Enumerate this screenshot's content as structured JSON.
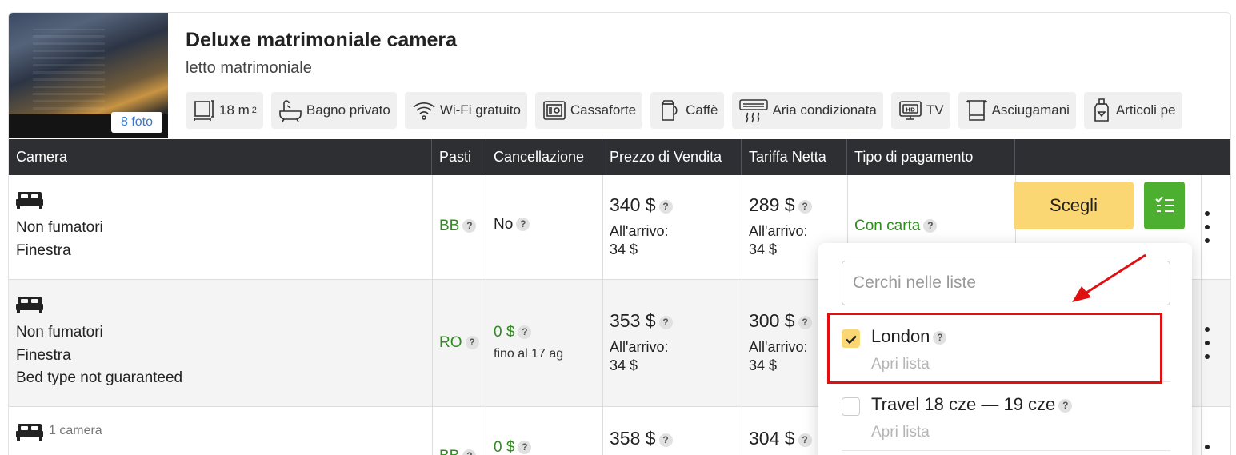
{
  "room": {
    "photo_badge": "8 foto",
    "title": "Deluxe matrimoniale camera",
    "subtitle": "letto matrimoniale",
    "amenities": [
      {
        "icon": "room-size-icon",
        "label": "18 m",
        "sup": "2"
      },
      {
        "icon": "bathtub-icon",
        "label": "Bagno privato"
      },
      {
        "icon": "wifi-icon",
        "label": "Wi-Fi gratuito"
      },
      {
        "icon": "safe-icon",
        "label": "Cassaforte"
      },
      {
        "icon": "kettle-icon",
        "label": "Caffè"
      },
      {
        "icon": "air-conditioner-icon",
        "label": "Aria condizionata"
      },
      {
        "icon": "tv-icon",
        "label": "TV"
      },
      {
        "icon": "towel-icon",
        "label": "Asciugamani"
      },
      {
        "icon": "toiletries-icon",
        "label": "Articoli pe"
      }
    ]
  },
  "table": {
    "headers": [
      "Camera",
      "Pasti",
      "Cancellazione",
      "Prezzo di Vendita",
      "Tariffa Netta",
      "Tipo di pagamento"
    ],
    "rows": [
      {
        "camera": [
          "Non fumatori",
          "Finestra"
        ],
        "pasti": "BB",
        "cancellazione": "No",
        "prezzo": "340 $",
        "prezzo_arrivo_label": "All'arrivo:",
        "prezzo_arrivo": "34 $",
        "netta": "289 $",
        "netta_arrivo_label": "All'arrivo:",
        "netta_arrivo": "34 $",
        "pagamento": "Con carta"
      },
      {
        "camera": [
          "Non fumatori",
          "Finestra",
          "Bed type not guaranteed"
        ],
        "pasti": "RO",
        "cancellazione": "0 $",
        "cancellazione_note": "fino al 17 ag",
        "prezzo": "353 $",
        "prezzo_arrivo_label": "All'arrivo:",
        "prezzo_arrivo": "34 $",
        "netta": "300 $",
        "netta_arrivo_label": "All'arrivo:",
        "netta_arrivo": "34 $"
      },
      {
        "camera_count": "1 camera",
        "pasti": "BB",
        "cancellazione": "0 $",
        "prezzo": "358 $",
        "netta": "304 $"
      }
    ],
    "select_button": "Scegli",
    "help_glyph": "?"
  },
  "dropdown": {
    "search_placeholder": "Cerchi nelle liste",
    "items": [
      {
        "label": "London",
        "link": "Apri lista",
        "checked": true
      },
      {
        "label": "Travel 18 cze — 19 cze",
        "link": "Apri lista",
        "checked": false
      }
    ]
  },
  "colors": {
    "header_bg": "#2d2f33",
    "select_button": "#fbd774",
    "list_button": "#4caf30",
    "highlight": "#e01010",
    "green_text": "#2e8b1e"
  }
}
